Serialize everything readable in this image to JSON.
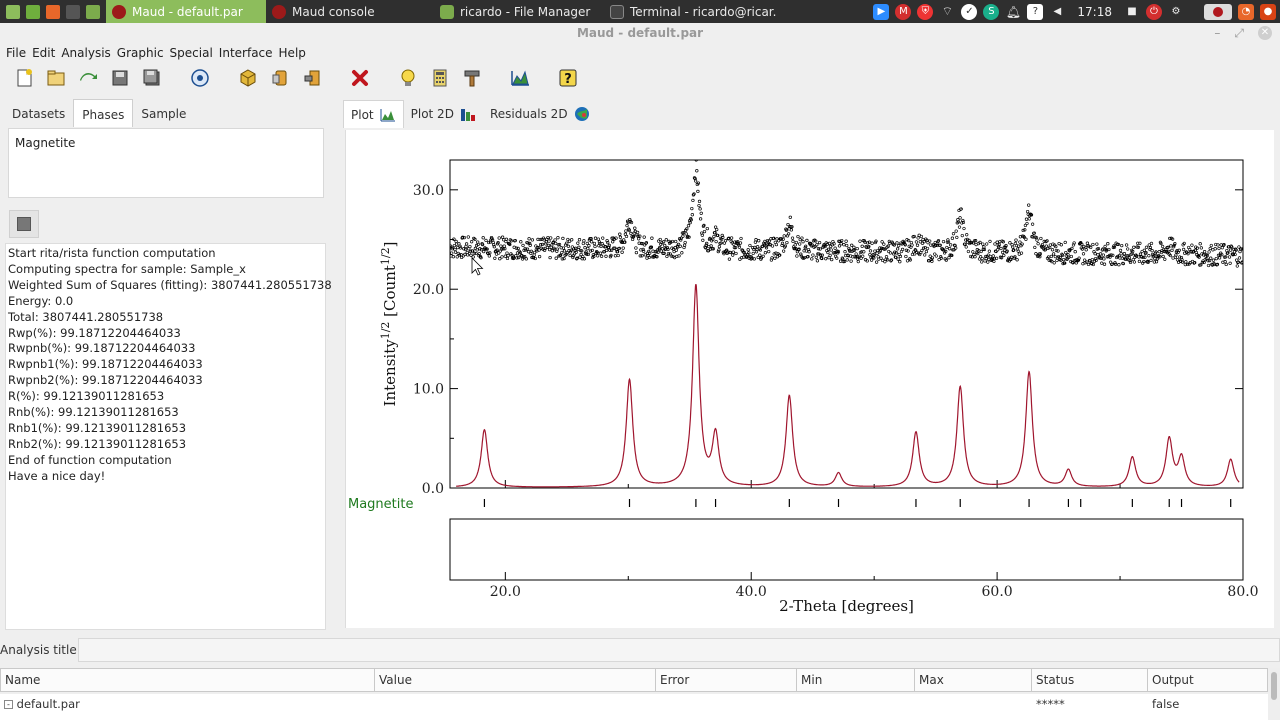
{
  "taskbar": {
    "tasks": [
      {
        "label": "Maud - default.par",
        "active": true
      },
      {
        "label": "Maud console"
      },
      {
        "label": "ricardo - File Manager"
      },
      {
        "label": "Terminal - ricardo@ricar..."
      }
    ],
    "clock": "17:18"
  },
  "window": {
    "title": "Maud - default.par"
  },
  "menu": [
    "File",
    "Edit",
    "Analysis",
    "Graphic",
    "Special",
    "Interface",
    "Help"
  ],
  "left": {
    "tabs": [
      "Datasets",
      "Phases",
      "Sample"
    ],
    "active_tab": "Phases",
    "phases": [
      "Magnetite"
    ],
    "log": [
      "Start rita/rista function computation",
      "Computing spectra for sample: Sample_x",
      "Weighted Sum of Squares (fitting): 3807441.280551738",
      "Energy: 0.0",
      "Total: 3807441.280551738",
      "Rwp(%): 99.18712204464033",
      "Rwpnb(%): 99.18712204464033",
      "Rwpnb1(%): 99.18712204464033",
      "Rwpnb2(%): 99.18712204464033",
      "R(%): 99.12139011281653",
      "Rnb(%): 99.12139011281653",
      "Rnb1(%): 99.12139011281653",
      "Rnb2(%): 99.12139011281653",
      "End of function computation",
      "Have a nice day!"
    ]
  },
  "right": {
    "tabs": [
      "Plot",
      "Plot 2D",
      "Residuals 2D"
    ],
    "active_tab": "Plot"
  },
  "chart_data": {
    "type": "line",
    "xlabel": "2-Theta [degrees]",
    "ylabel_base": "Intensity",
    "ylabel_exp": "1/2",
    "ylabel_unit_base": "[Count",
    "ylabel_unit_exp": "1/2",
    "ylabel_unit_close": "]",
    "xlim": [
      15.5,
      80.0
    ],
    "ylim": [
      0.0,
      33.0
    ],
    "xticks": [
      20.0,
      40.0,
      60.0,
      80.0
    ],
    "xtick_labels": [
      "20.0",
      "40.0",
      "60.0",
      "80.0"
    ],
    "yticks": [
      0.0,
      10.0,
      20.0,
      30.0
    ],
    "ytick_labels": [
      "0.0",
      "10.0",
      "20.0",
      "30.0"
    ],
    "series": [
      {
        "role": "observed",
        "style": "markers",
        "color": "#000000",
        "baseline": 24.2,
        "peaks": [
          [
            30.1,
            3.0
          ],
          [
            35.5,
            8.0
          ],
          [
            37.1,
            1.0
          ],
          [
            43.1,
            2.6
          ],
          [
            53.5,
            1.0
          ],
          [
            57.0,
            3.5
          ],
          [
            62.6,
            4.0
          ],
          [
            74.0,
            0.8
          ]
        ]
      },
      {
        "role": "calculated",
        "style": "line",
        "color": "#a0162e",
        "baseline": 0.0,
        "peaks": [
          [
            18.3,
            5.8
          ],
          [
            30.1,
            10.8
          ],
          [
            35.5,
            20.2
          ],
          [
            37.1,
            5.1
          ],
          [
            43.1,
            9.2
          ],
          [
            47.1,
            1.4
          ],
          [
            53.4,
            5.5
          ],
          [
            57.0,
            10.1
          ],
          [
            62.6,
            11.6
          ],
          [
            65.8,
            1.7
          ],
          [
            71.0,
            3.0
          ],
          [
            74.0,
            4.8
          ],
          [
            75.0,
            2.9
          ],
          [
            79.0,
            2.8
          ]
        ]
      }
    ],
    "phase": {
      "name": "Magnetite",
      "color": "#1f7a1f",
      "reflections": [
        18.3,
        30.1,
        35.5,
        37.1,
        43.1,
        47.1,
        53.4,
        57.0,
        62.6,
        65.8,
        66.8,
        71.0,
        74.0,
        75.0,
        79.0
      ]
    }
  },
  "bottom": {
    "analysis_label": "Analysis title:",
    "columns": [
      "Name",
      "Value",
      "Error",
      "Min",
      "Max",
      "Status",
      "Output"
    ],
    "row": {
      "name": "default.par",
      "status": "*****",
      "output": "false"
    }
  }
}
